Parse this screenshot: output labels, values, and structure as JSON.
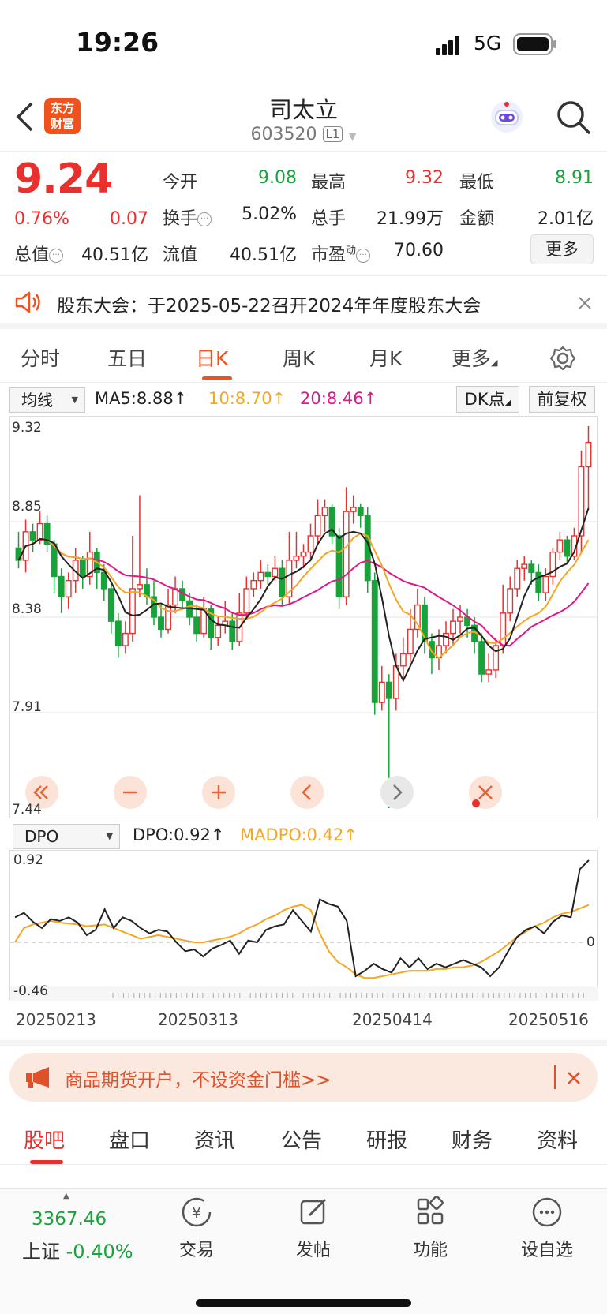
{
  "status": {
    "time": "19:26",
    "network": "5G"
  },
  "header": {
    "logo": [
      "东方",
      "财富"
    ],
    "title": "司太立",
    "code": "603520",
    "level": "L1"
  },
  "quote": {
    "price": "9.24",
    "change_pct": "0.76%",
    "change": "0.07",
    "open_label": "今开",
    "open": "9.08",
    "high_label": "最高",
    "high": "9.32",
    "low_label": "最低",
    "low": "8.91",
    "turnover_label": "换手",
    "turnover": "5.02%",
    "volume_label": "总手",
    "volume": "21.99万",
    "amount_label": "金额",
    "amount": "2.01亿",
    "mktcap_label": "总值",
    "mktcap": "40.51亿",
    "float_label": "流值",
    "float": "40.51亿",
    "pe_label": "市盈",
    "pe_sup": "动",
    "pe": "70.60",
    "more": "更多"
  },
  "notice": {
    "text": "股东大会：于2025-05-22召开2024年年度股东大会"
  },
  "tabs": [
    "分时",
    "五日",
    "日K",
    "周K",
    "月K",
    "更多"
  ],
  "indicators": {
    "selector": "均线",
    "ma5": "MA5:8.88↑",
    "ma10": "10:8.70↑",
    "ma20": "20:8.46↑",
    "dk": "DK点",
    "adjust": "前复权",
    "colors": {
      "ma5": "#222222",
      "ma10": "#f5a623",
      "ma20": "#e0198a",
      "up": "#e8312f",
      "down": "#18a33a"
    }
  },
  "chart_data": [
    {
      "type": "candlestick",
      "title": "",
      "y_ticks": [
        "9.32",
        "8.85",
        "8.38",
        "7.91",
        "7.44"
      ],
      "ylim": [
        7.44,
        9.32
      ],
      "candles": [
        [
          8.72,
          8.66,
          8.8,
          8.62
        ],
        [
          8.66,
          8.8,
          8.86,
          8.6
        ],
        [
          8.8,
          8.76,
          8.84,
          8.7
        ],
        [
          8.76,
          8.84,
          8.9,
          8.74
        ],
        [
          8.84,
          8.74,
          8.88,
          8.7
        ],
        [
          8.74,
          8.58,
          8.76,
          8.5
        ],
        [
          8.58,
          8.48,
          8.62,
          8.4
        ],
        [
          8.48,
          8.56,
          8.6,
          8.42
        ],
        [
          8.56,
          8.66,
          8.72,
          8.5
        ],
        [
          8.66,
          8.58,
          8.68,
          8.52
        ],
        [
          8.58,
          8.7,
          8.8,
          8.54
        ],
        [
          8.7,
          8.6,
          8.72,
          8.52
        ],
        [
          8.6,
          8.52,
          8.64,
          8.46
        ],
        [
          8.52,
          8.36,
          8.56,
          8.3
        ],
        [
          8.36,
          8.24,
          8.4,
          8.18
        ],
        [
          8.24,
          8.3,
          8.36,
          8.2
        ],
        [
          8.3,
          8.52,
          8.78,
          8.26
        ],
        [
          8.52,
          8.54,
          8.98,
          8.48
        ],
        [
          8.54,
          8.48,
          8.62,
          8.44
        ],
        [
          8.48,
          8.38,
          8.56,
          8.34
        ],
        [
          8.38,
          8.32,
          8.44,
          8.28
        ],
        [
          8.32,
          8.44,
          8.52,
          8.3
        ],
        [
          8.44,
          8.52,
          8.58,
          8.4
        ],
        [
          8.52,
          8.46,
          8.56,
          8.42
        ],
        [
          8.46,
          8.38,
          8.5,
          8.34
        ],
        [
          8.38,
          8.3,
          8.44,
          8.26
        ],
        [
          8.3,
          8.42,
          8.48,
          8.28
        ],
        [
          8.42,
          8.28,
          8.44,
          8.22
        ],
        [
          8.28,
          8.34,
          8.38,
          8.24
        ],
        [
          8.34,
          8.36,
          8.46,
          8.3
        ],
        [
          8.36,
          8.26,
          8.4,
          8.22
        ],
        [
          8.26,
          8.4,
          8.5,
          8.24
        ],
        [
          8.4,
          8.52,
          8.58,
          8.38
        ],
        [
          8.52,
          8.56,
          8.6,
          8.48
        ],
        [
          8.56,
          8.6,
          8.66,
          8.52
        ],
        [
          8.6,
          8.58,
          8.64,
          8.54
        ],
        [
          8.58,
          8.62,
          8.68,
          8.56
        ],
        [
          8.62,
          8.48,
          8.66,
          8.44
        ],
        [
          8.48,
          8.66,
          8.8,
          8.44
        ],
        [
          8.66,
          8.68,
          8.8,
          8.62
        ],
        [
          8.68,
          8.7,
          8.74,
          8.62
        ],
        [
          8.7,
          8.78,
          8.84,
          8.66
        ],
        [
          8.78,
          8.88,
          8.96,
          8.74
        ],
        [
          8.88,
          8.92,
          8.96,
          8.8
        ],
        [
          8.92,
          8.78,
          8.94,
          8.74
        ],
        [
          8.78,
          8.48,
          8.82,
          8.42
        ],
        [
          8.48,
          8.9,
          9.02,
          8.44
        ],
        [
          8.9,
          8.92,
          8.98,
          8.84
        ],
        [
          8.92,
          8.88,
          8.94,
          8.82
        ],
        [
          8.88,
          8.56,
          8.92,
          8.5
        ],
        [
          8.56,
          7.96,
          8.6,
          7.9
        ],
        [
          7.96,
          8.06,
          8.14,
          7.92
        ],
        [
          8.06,
          7.98,
          8.1,
          7.44
        ],
        [
          7.98,
          8.14,
          8.2,
          7.92
        ],
        [
          8.14,
          8.2,
          8.28,
          8.08
        ],
        [
          8.2,
          8.32,
          8.42,
          8.16
        ],
        [
          8.32,
          8.44,
          8.52,
          8.28
        ],
        [
          8.44,
          8.26,
          8.48,
          8.2
        ],
        [
          8.26,
          8.18,
          8.3,
          8.1
        ],
        [
          8.18,
          8.24,
          8.32,
          8.12
        ],
        [
          8.24,
          8.3,
          8.36,
          8.2
        ],
        [
          8.3,
          8.36,
          8.42,
          8.24
        ],
        [
          8.36,
          8.38,
          8.44,
          8.3
        ],
        [
          8.38,
          8.34,
          8.42,
          8.28
        ],
        [
          8.34,
          8.26,
          8.38,
          8.2
        ],
        [
          8.26,
          8.1,
          8.3,
          8.06
        ],
        [
          8.1,
          8.12,
          8.2,
          8.06
        ],
        [
          8.12,
          8.24,
          8.28,
          8.08
        ],
        [
          8.24,
          8.4,
          8.54,
          8.2
        ],
        [
          8.4,
          8.52,
          8.58,
          8.36
        ],
        [
          8.52,
          8.62,
          8.66,
          8.48
        ],
        [
          8.62,
          8.64,
          8.68,
          8.56
        ],
        [
          8.64,
          8.6,
          8.66,
          8.54
        ],
        [
          8.6,
          8.5,
          8.64,
          8.46
        ],
        [
          8.5,
          8.58,
          8.62,
          8.46
        ],
        [
          8.58,
          8.7,
          8.72,
          8.54
        ],
        [
          8.7,
          8.76,
          8.8,
          8.66
        ],
        [
          8.76,
          8.68,
          8.78,
          8.64
        ],
        [
          8.68,
          8.78,
          8.82,
          8.66
        ],
        [
          8.78,
          9.12,
          9.2,
          8.7
        ],
        [
          9.12,
          9.24,
          9.32,
          8.91
        ]
      ]
    },
    {
      "type": "line",
      "title": "",
      "y_ticks": [
        "0.92",
        "0",
        "-0.46"
      ],
      "ylim": [
        -0.46,
        0.92
      ],
      "x_labels": [
        "20250213",
        "20250313",
        "20250414",
        "20250516"
      ],
      "series": [
        {
          "name": "DPO:0.92↑",
          "color": "#222222",
          "values": [
            0.28,
            0.33,
            0.23,
            0.16,
            0.26,
            0.24,
            0.28,
            0.22,
            0.08,
            0.14,
            0.37,
            0.16,
            0.28,
            0.24,
            0.16,
            0.1,
            0.14,
            0.12,
            0.0,
            -0.1,
            -0.08,
            -0.16,
            -0.07,
            -0.03,
            0.02,
            -0.13,
            0.02,
            0.0,
            0.14,
            0.18,
            0.2,
            0.36,
            0.24,
            0.12,
            0.48,
            0.43,
            0.4,
            0.24,
            -0.38,
            -0.32,
            -0.24,
            -0.3,
            -0.34,
            -0.18,
            -0.28,
            -0.18,
            -0.3,
            -0.24,
            -0.28,
            -0.24,
            -0.2,
            -0.24,
            -0.28,
            -0.38,
            -0.28,
            -0.1,
            0.06,
            0.14,
            0.18,
            0.1,
            0.23,
            0.3,
            0.28,
            0.82,
            0.92
          ]
        },
        {
          "name": "MADPO:0.42↑",
          "color": "#f5a623",
          "values": [
            0.0,
            0.16,
            0.2,
            0.22,
            0.24,
            0.22,
            0.21,
            0.2,
            0.18,
            0.19,
            0.2,
            0.16,
            0.12,
            0.08,
            0.04,
            0.06,
            0.08,
            0.06,
            0.04,
            0.02,
            0.0,
            0.0,
            0.02,
            0.04,
            0.06,
            0.1,
            0.16,
            0.2,
            0.26,
            0.3,
            0.36,
            0.4,
            0.42,
            0.36,
            0.1,
            -0.1,
            -0.22,
            -0.28,
            -0.36,
            -0.4,
            -0.4,
            -0.38,
            -0.36,
            -0.34,
            -0.32,
            -0.32,
            -0.32,
            -0.3,
            -0.3,
            -0.28,
            -0.28,
            -0.26,
            -0.22,
            -0.16,
            -0.1,
            -0.02,
            0.06,
            0.12,
            0.18,
            0.22,
            0.28,
            0.32,
            0.34,
            0.38,
            0.42
          ]
        }
      ]
    }
  ],
  "dpo": {
    "selector": "DPO",
    "dpo": "DPO:0.92↑",
    "madpo": "MADPO:0.42↑"
  },
  "dates": [
    "20250213",
    "20250313",
    "20250414",
    "20250516"
  ],
  "ad": {
    "text": "商品期货开户，不设资金门槛>>"
  },
  "subtabs": [
    "股吧",
    "盘口",
    "资讯",
    "公告",
    "研报",
    "财务",
    "资料"
  ],
  "bottom": {
    "index_value": "3367.46",
    "index_name": "上证",
    "index_change": "-0.40%",
    "items": [
      "交易",
      "发帖",
      "功能",
      "设自选"
    ]
  }
}
